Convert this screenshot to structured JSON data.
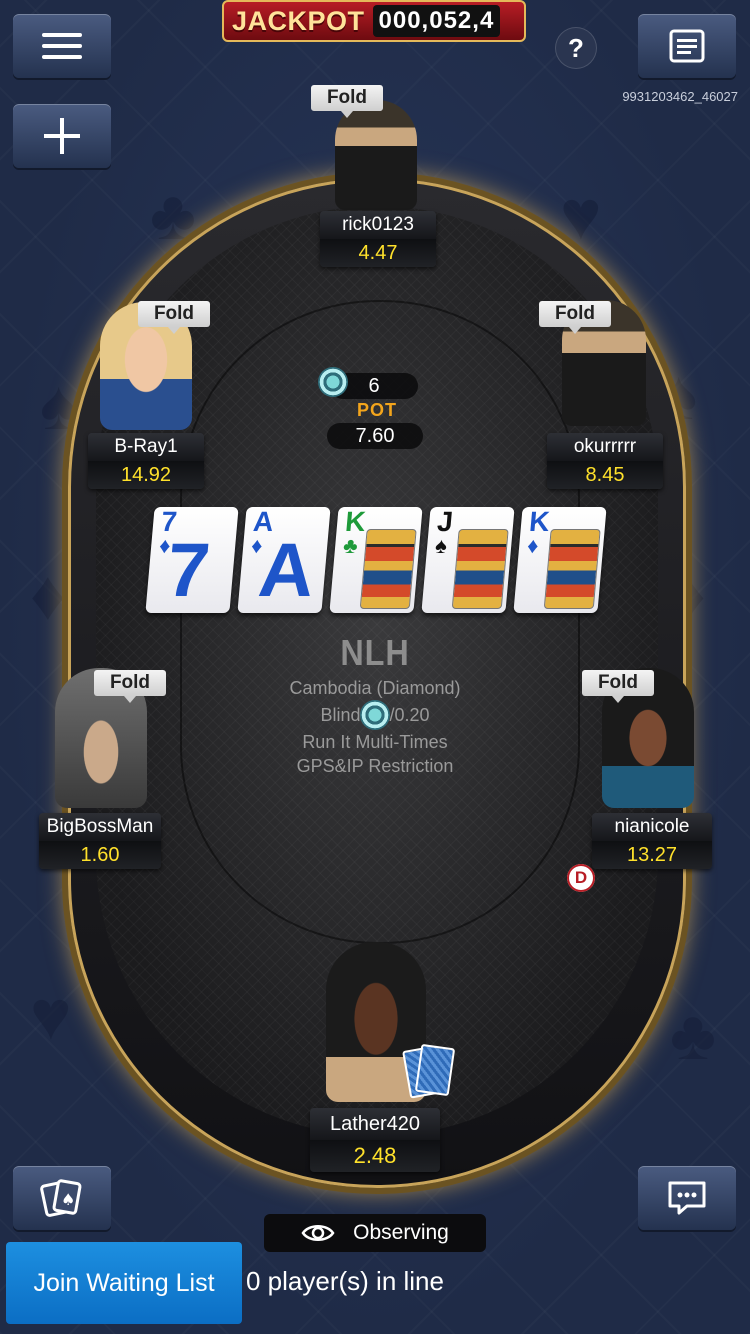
{
  "header": {
    "jackpot_label": "JACKPOT",
    "jackpot_value": "000,052,4",
    "help_label": "?",
    "table_id": "9931203462_46027"
  },
  "icons": {
    "menu": "hamburger-menu-icon",
    "add": "plus-icon",
    "history": "hand-history-icon",
    "cards": "cards-icon",
    "chat": "chat-icon",
    "eye": "eye-icon"
  },
  "players": {
    "top": {
      "name": "rick0123",
      "stack": "4.47",
      "status": "Fold"
    },
    "upper_left": {
      "name": "B-Ray1",
      "stack": "14.92",
      "status": "Fold"
    },
    "upper_right": {
      "name": "okurrrrr",
      "stack": "8.45",
      "status": "Fold"
    },
    "lower_left": {
      "name": "BigBossMan",
      "stack": "1.60",
      "status": "Fold"
    },
    "lower_right": {
      "name": "nianicole",
      "stack": "13.27",
      "status": "Fold"
    },
    "bottom": {
      "name": "Lather420",
      "stack": "2.48"
    }
  },
  "pot": {
    "chip_count": "6",
    "label": "POT",
    "amount": "7.60"
  },
  "board": [
    {
      "rank": "7",
      "suit": "♦",
      "color": "#1e55c9",
      "type": "number"
    },
    {
      "rank": "A",
      "suit": "♦",
      "color": "#1e55c9",
      "type": "number"
    },
    {
      "rank": "K",
      "suit": "♣",
      "color": "#1e9a3a",
      "type": "face"
    },
    {
      "rank": "J",
      "suit": "♠",
      "color": "#111111",
      "type": "face"
    },
    {
      "rank": "K",
      "suit": "♦",
      "color": "#1e55c9",
      "type": "face"
    }
  ],
  "table_info": {
    "game": "NLH",
    "name": "Cambodia (Diamond)",
    "blinds": "Blinds: 0/0.20",
    "rule1": "Run It Multi-Times",
    "rule2": "GPS&IP Restriction"
  },
  "dealer_button": "D",
  "footer": {
    "observing": "Observing",
    "join_button": "Join Waiting List",
    "queue": "0 player(s) in line"
  },
  "colors": {
    "stack_yellow": "#ffe12b",
    "pot_orange": "#f3a51c",
    "join_blue": "#1d8fe0",
    "jackpot_red": "#b71d25"
  }
}
